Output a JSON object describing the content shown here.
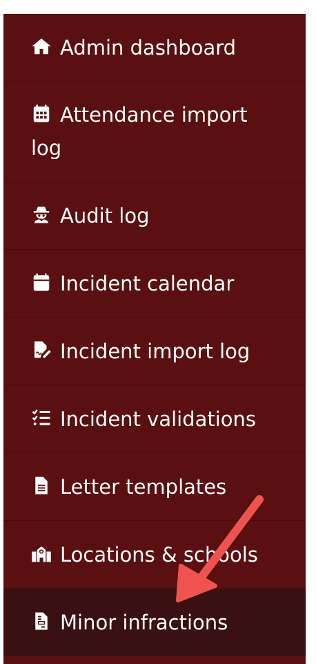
{
  "sidebar": {
    "items": [
      {
        "label": "Admin dashboard",
        "icon": "home-icon"
      },
      {
        "label": "Attendance import log",
        "icon": "calendar-grid-icon"
      },
      {
        "label": "Audit log",
        "icon": "spy-icon"
      },
      {
        "label": "Incident calendar",
        "icon": "calendar-icon"
      },
      {
        "label": "Incident import log",
        "icon": "file-signature-icon"
      },
      {
        "label": "Incident validations",
        "icon": "checklist-icon"
      },
      {
        "label": "Letter templates",
        "icon": "file-text-icon"
      },
      {
        "label": "Locations & schools",
        "icon": "school-icon"
      },
      {
        "label": "Minor infractions",
        "icon": "file-invoice-icon"
      }
    ],
    "active_index": 8
  },
  "colors": {
    "sidebar_bg": "#5a0f10",
    "active_bg": "#3a1112",
    "divider": "#4a0b0c",
    "arrow": "#ef5350"
  }
}
